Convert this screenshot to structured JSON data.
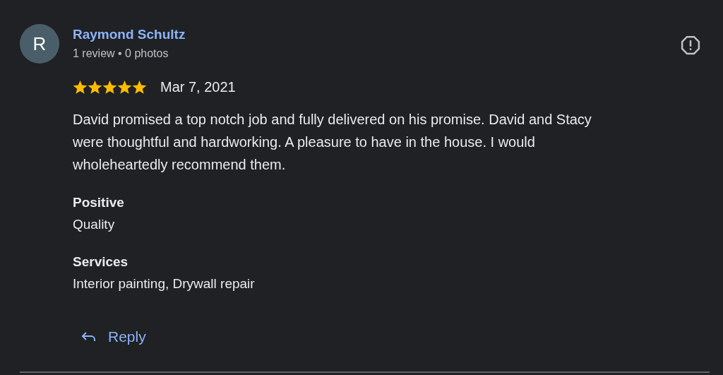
{
  "review": {
    "avatar_letter": "R",
    "author": "Raymond Schultz",
    "author_meta": "1 review • 0 photos",
    "stars": 5,
    "date": "Mar 7, 2021",
    "text": "David promised a top notch job and fully delivered on his promise. David and Stacy were thoughtful and hardworking. A pleasure to have in the house. I would wholeheartedly recommend them.",
    "attributes": [
      {
        "label": "Positive",
        "value": "Quality"
      },
      {
        "label": "Services",
        "value": "Interior painting, Drywall repair"
      }
    ],
    "reply_button": "Reply"
  }
}
